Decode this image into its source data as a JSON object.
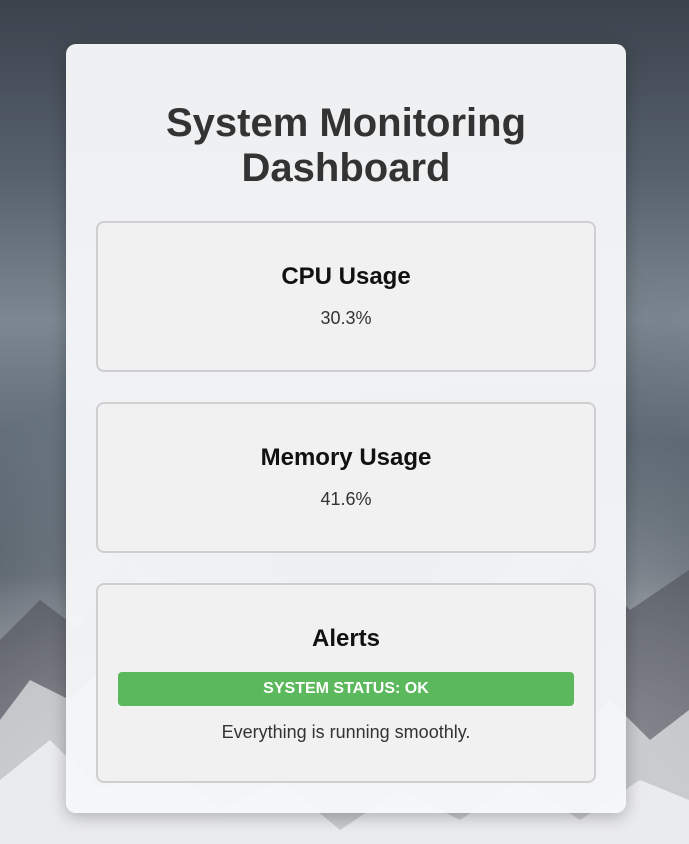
{
  "page": {
    "title": "System Monitoring Dashboard"
  },
  "cpu": {
    "title": "CPU Usage",
    "value": "30.3%"
  },
  "memory": {
    "title": "Memory Usage",
    "value": "41.6%"
  },
  "alerts": {
    "title": "Alerts",
    "status": "SYSTEM STATUS: OK",
    "message": "Everything is running smoothly."
  },
  "colors": {
    "status_ok": "#5cb85c",
    "card_background": "#f6f7f8",
    "panel_background": "#f1f1f2",
    "text_primary": "#333333"
  }
}
